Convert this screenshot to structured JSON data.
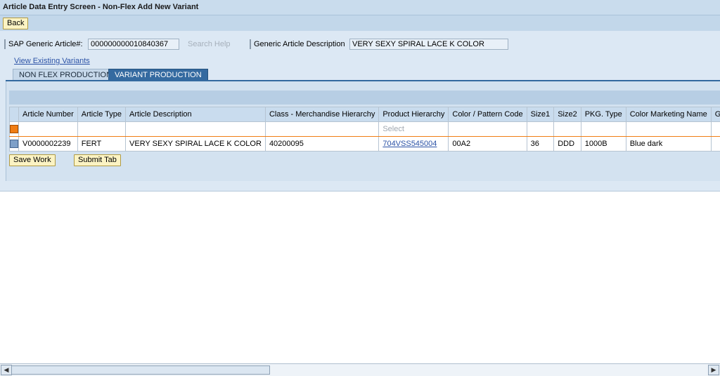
{
  "header": {
    "title": "Article Data Entry Screen - Non-Flex Add New Variant"
  },
  "toolbar": {
    "back_label": "Back"
  },
  "form": {
    "generic_article_label": "SAP Generic Article#:",
    "generic_article_value": "000000000010840367",
    "search_help_label": "Search Help",
    "description_label": "Generic Article Description",
    "description_value": "VERY SEXY SPIRAL LACE K COLOR",
    "view_variants_link": "View Existing Variants"
  },
  "tabs": [
    {
      "label": "NON FLEX PRODUCTION",
      "active": false
    },
    {
      "label": "VARIANT PRODUCTION",
      "active": true
    }
  ],
  "table": {
    "columns": [
      "Article Number",
      "Article Type",
      "Article Description",
      "Class - Merchandise Hierarchy",
      "Product Hierarchy",
      "Color / Pattern Code",
      "Size1",
      "Size2",
      "PKG. Type",
      "Color Marketing Name",
      "Goods ("
    ],
    "new_row": {
      "product_hierarchy_placeholder": "Select"
    },
    "rows": [
      {
        "article_number": "V0000002239",
        "article_type": "FERT",
        "article_description": "VERY SEXY SPIRAL LACE K COLOR",
        "merch_hierarchy": "40200095",
        "product_hierarchy": "704VSS545004",
        "color_code": "00A2",
        "size1": "36",
        "size2": "DDD",
        "pkg_type": "1000B",
        "color_marketing_name": "Blue dark",
        "goods": ""
      }
    ]
  },
  "actions": {
    "save_label": "Save Work",
    "submit_label": "Submit Tab"
  },
  "colors": {
    "accent_tab": "#346aa0",
    "button_bg": "#fbf3c3",
    "new_row_marker": "#f07d14",
    "link": "#2b52a6"
  }
}
